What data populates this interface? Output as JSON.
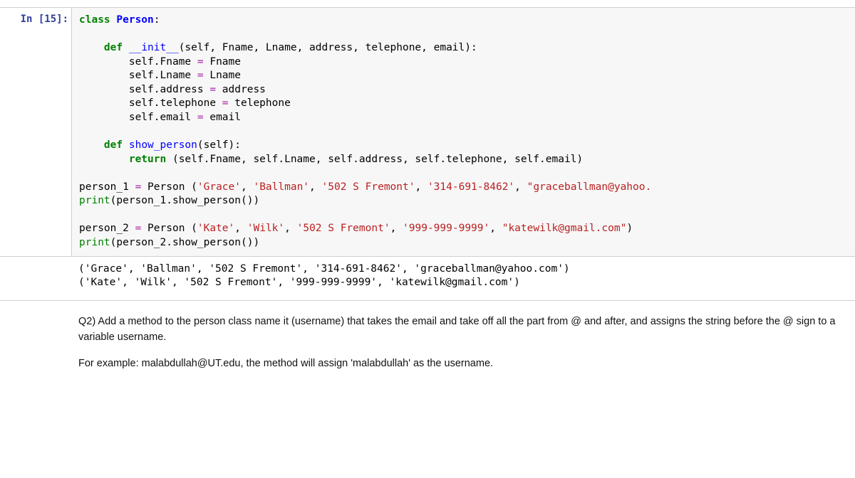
{
  "prompt": {
    "label": "In [",
    "num": "15",
    "close": "]:"
  },
  "code": {
    "l01a": "class",
    "l01b": "Person",
    "l03a": "def",
    "l03b": "__init__",
    "l03c": "(self, Fname, Lname, address, telephone, email):",
    "l04a": "self.Fname ",
    "l04eq": "=",
    "l04b": " Fname",
    "l05a": "self.Lname ",
    "l05eq": "=",
    "l05b": " Lname",
    "l06a": "self.address ",
    "l06eq": "=",
    "l06b": " address",
    "l07a": "self.telephone ",
    "l07eq": "=",
    "l07b": " telephone",
    "l08a": "self.email ",
    "l08eq": "=",
    "l08b": " email",
    "l10a": "def",
    "l10b": "show_person",
    "l10c": "(self):",
    "l11a": "return",
    "l11b": " (self.Fname, self.Lname, self.address, self.telephone, self.email)",
    "l13a": "person_1 ",
    "l13eq": "=",
    "l13b": " Person (",
    "l13s1": "'Grace'",
    "l13c": ", ",
    "l13s2": "'Ballman'",
    "l13d": ", ",
    "l13s3": "'502 S Fremont'",
    "l13e": ", ",
    "l13s4": "'314-691-8462'",
    "l13f": ", ",
    "l13s5": "\"graceballman@yahoo.",
    "l13g": "",
    "l14a": "print",
    "l14b": "(person_1.show_person())",
    "l16a": "person_2 ",
    "l16eq": "=",
    "l16b": " Person (",
    "l16s1": "'Kate'",
    "l16c": ", ",
    "l16s2": "'Wilk'",
    "l16d": ", ",
    "l16s3": "'502 S Fremont'",
    "l16e": ", ",
    "l16s4": "'999-999-9999'",
    "l16f": ", ",
    "l16s5": "\"katewilk@gmail.com\"",
    "l16g": ")",
    "l17a": "print",
    "l17b": "(person_2.show_person())"
  },
  "output": {
    "line1": "('Grace', 'Ballman', '502 S Fremont', '314-691-8462', 'graceballman@yahoo.com')",
    "line2": "('Kate', 'Wilk', '502 S Fremont', '999-999-9999', 'katewilk@gmail.com')"
  },
  "markdown": {
    "p1": "Q2) Add a method to the person class name it (username) that takes the email and take off all the part from @ and after, and assigns the string before the @ sign to a variable username.",
    "p2": "For example: malabdullah@UT.edu, the method will assign 'malabdullah' as the username."
  }
}
